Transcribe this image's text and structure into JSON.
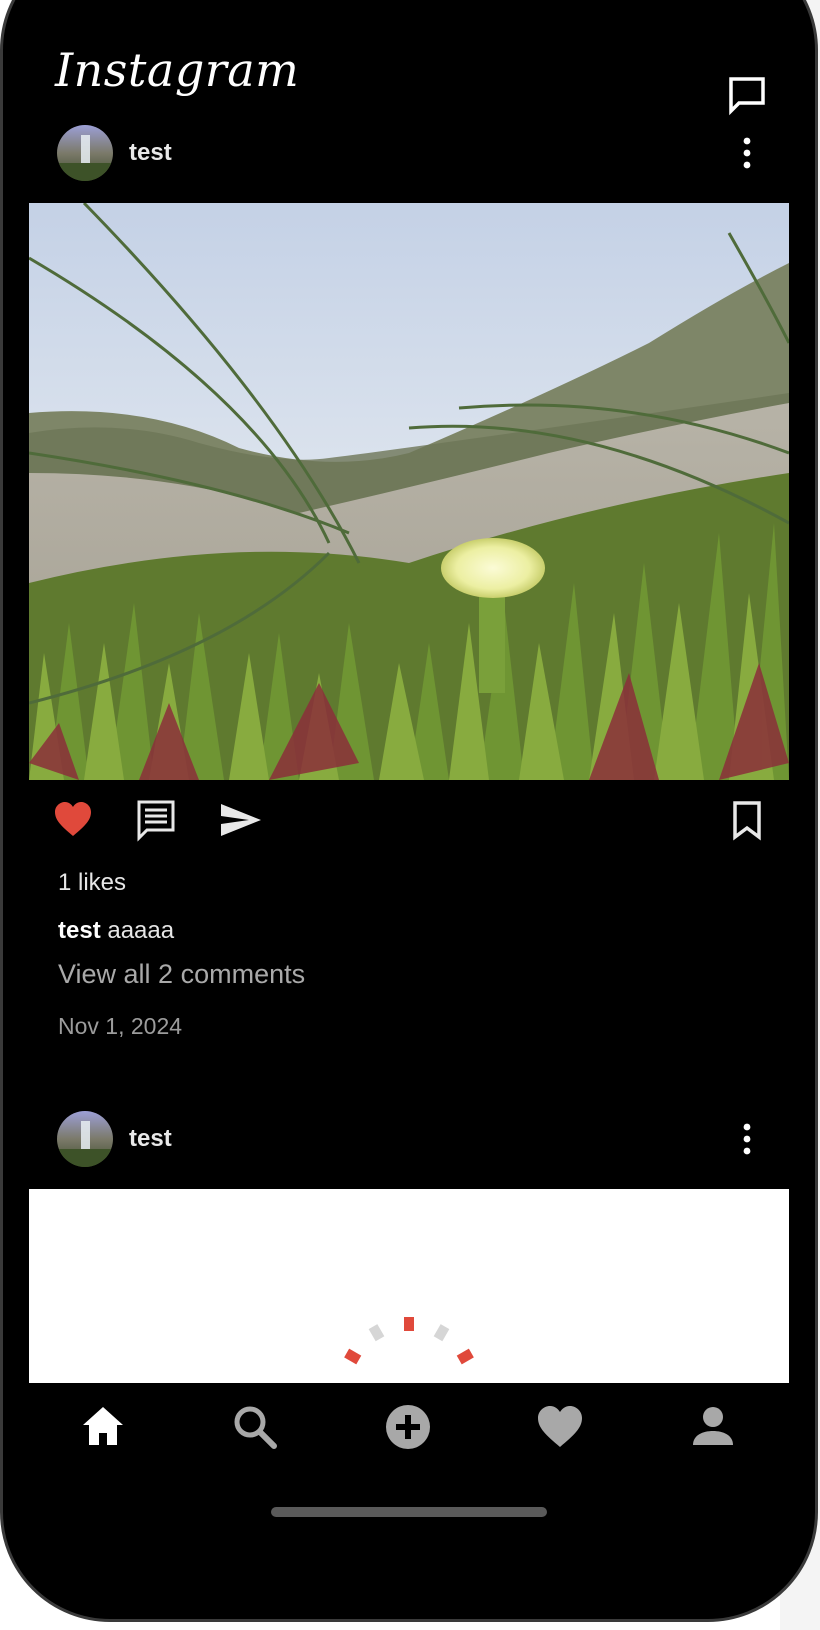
{
  "app": {
    "logo": "Instagram"
  },
  "posts": [
    {
      "username": "test",
      "likes_text": "1 likes",
      "caption_user": "test",
      "caption_text": " aaaaa",
      "comments_link": "View all 2 comments",
      "date": "Nov 1, 2024",
      "liked": true
    },
    {
      "username": "test"
    }
  ],
  "icons": {
    "dm": "message-square-icon",
    "more": "more-vertical-icon",
    "like": "heart-icon",
    "comment": "comment-icon",
    "share": "send-icon",
    "save": "bookmark-icon",
    "loading": "spinner-icon"
  },
  "bottom_nav": [
    {
      "name": "home",
      "icon": "home-icon",
      "active": true
    },
    {
      "name": "search",
      "icon": "search-icon",
      "active": false
    },
    {
      "name": "create",
      "icon": "add-circle-icon",
      "active": false
    },
    {
      "name": "activity",
      "icon": "heart-icon",
      "active": false
    },
    {
      "name": "profile",
      "icon": "person-icon",
      "active": false
    }
  ],
  "colors": {
    "background": "#000000",
    "like_active": "#e0493b",
    "text_primary": "#e9e9e9",
    "text_secondary": "#a9a9a9",
    "nav_inactive": "#a8a8a8"
  }
}
